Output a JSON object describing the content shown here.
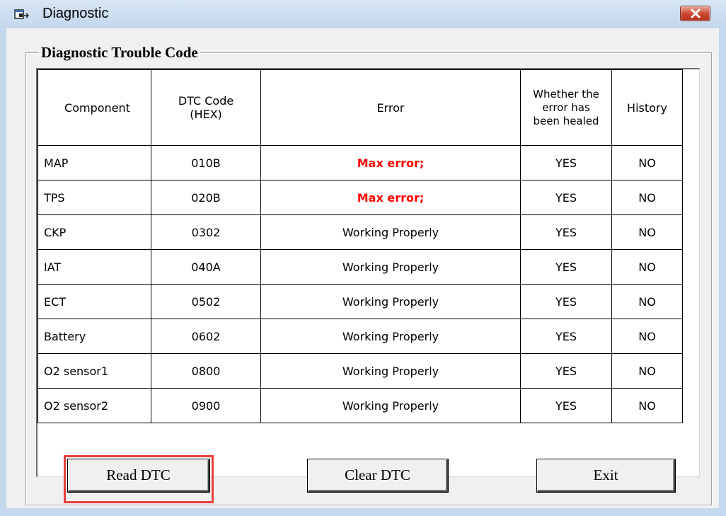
{
  "window": {
    "title": "Diagnostic",
    "accent_close": "#c9452e",
    "title_bar_color": "#c4d8ee"
  },
  "group": {
    "label": "Diagnostic Trouble Code"
  },
  "table": {
    "headers": {
      "component": "Component",
      "dtc_code_line1": "DTC Code",
      "dtc_code_line2": "(HEX)",
      "error": "Error",
      "healed_line1": "Whether the",
      "healed_line2": "error has",
      "healed_line3": "been healed",
      "history": "History"
    },
    "rows": [
      {
        "component": "MAP",
        "code": "010B",
        "error": "Max error;",
        "healed": "YES",
        "history": "NO"
      },
      {
        "component": "TPS",
        "code": "020B",
        "error": "Max error;",
        "healed": "YES",
        "history": "NO"
      },
      {
        "component": "CKP",
        "code": "0302",
        "error": "Working Properly",
        "healed": "YES",
        "history": "NO"
      },
      {
        "component": "IAT",
        "code": "040A",
        "error": "Working Properly",
        "healed": "YES",
        "history": "NO"
      },
      {
        "component": "ECT",
        "code": "0502",
        "error": "Working Properly",
        "healed": "YES",
        "history": "NO"
      },
      {
        "component": "Battery",
        "code": "0602",
        "error": "Working Properly",
        "healed": "YES",
        "history": "NO"
      },
      {
        "component": "O2 sensor1",
        "code": "0800",
        "error": "Working Properly",
        "healed": "YES",
        "history": "NO"
      },
      {
        "component": "O2 sensor2",
        "code": "0900",
        "error": "Working Properly",
        "healed": "YES",
        "history": "NO"
      }
    ],
    "error_color": "#ff0000"
  },
  "buttons": {
    "read": "Read DTC",
    "clear": "Clear DTC",
    "exit": "Exit"
  },
  "highlight_color": "#e8403a"
}
